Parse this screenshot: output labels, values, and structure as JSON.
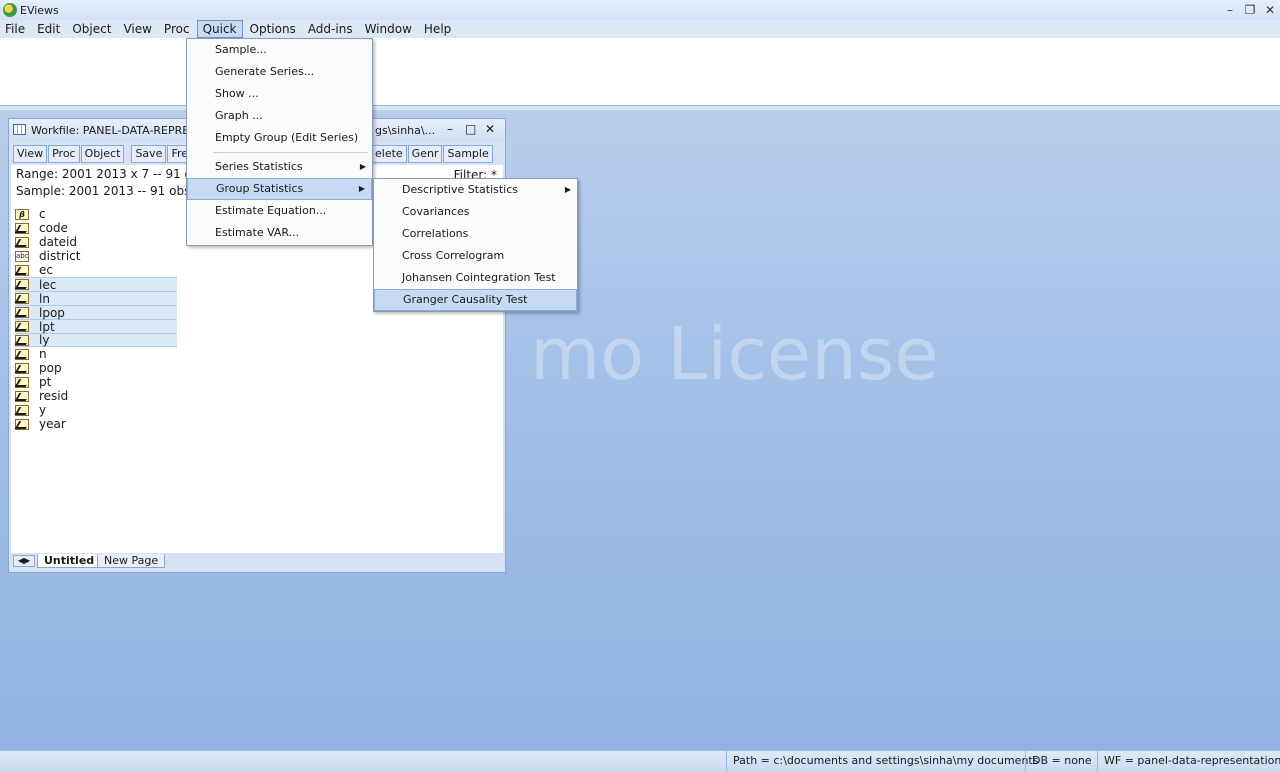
{
  "app": {
    "title": "EViews"
  },
  "menubar": {
    "items": [
      {
        "label": "File"
      },
      {
        "label": "Edit"
      },
      {
        "label": "Object"
      },
      {
        "label": "View"
      },
      {
        "label": "Proc"
      },
      {
        "label": "Quick"
      },
      {
        "label": "Options"
      },
      {
        "label": "Add-ins"
      },
      {
        "label": "Window"
      },
      {
        "label": "Help"
      }
    ]
  },
  "watermark": "mo License",
  "workfile": {
    "title": "Workfile: PANEL-DATA-REPRES",
    "path_suffix": "gs\\sinha\\...",
    "toolbar_left": [
      "View",
      "Proc",
      "Object",
      "Save",
      "Freeze"
    ],
    "toolbar_right": [
      "elete",
      "Genr",
      "Sample"
    ],
    "range_label": "Range:  2001 2013 x 7   --   91 o",
    "sample_label": "Sample: 2001 2013  --   91 obs",
    "filter_label": "Filter: *",
    "objects": [
      {
        "name": "c",
        "type": "coef"
      },
      {
        "name": "code",
        "type": "series"
      },
      {
        "name": "dateid",
        "type": "series"
      },
      {
        "name": "district",
        "type": "alpha"
      },
      {
        "name": "ec",
        "type": "series"
      },
      {
        "name": "lec",
        "type": "series"
      },
      {
        "name": "ln",
        "type": "series"
      },
      {
        "name": "lpop",
        "type": "series"
      },
      {
        "name": "lpt",
        "type": "series"
      },
      {
        "name": "ly",
        "type": "series"
      },
      {
        "name": "n",
        "type": "series"
      },
      {
        "name": "pop",
        "type": "series"
      },
      {
        "name": "pt",
        "type": "series"
      },
      {
        "name": "resid",
        "type": "series"
      },
      {
        "name": "y",
        "type": "series"
      },
      {
        "name": "year",
        "type": "series"
      }
    ],
    "tabs": [
      "Untitled",
      "New Page"
    ]
  },
  "quick_menu": {
    "items": [
      {
        "label": "Sample..."
      },
      {
        "label": "Generate Series..."
      },
      {
        "label": "Show ..."
      },
      {
        "label": "Graph ..."
      },
      {
        "label": "Empty Group (Edit Series)"
      },
      {
        "label": "Series Statistics"
      },
      {
        "label": "Group Statistics"
      },
      {
        "label": "Estimate Equation..."
      },
      {
        "label": "Estimate VAR..."
      }
    ]
  },
  "group_stats_menu": {
    "items": [
      {
        "label": "Descriptive Statistics"
      },
      {
        "label": "Covariances"
      },
      {
        "label": "Correlations"
      },
      {
        "label": "Cross Correlogram"
      },
      {
        "label": "Johansen Cointegration Test"
      },
      {
        "label": "Granger Causality Test"
      }
    ]
  },
  "statusbar": {
    "path": "Path = c:\\documents and settings\\sinha\\my documents",
    "db": "DB = none",
    "wf": "WF = panel-data-representation"
  }
}
